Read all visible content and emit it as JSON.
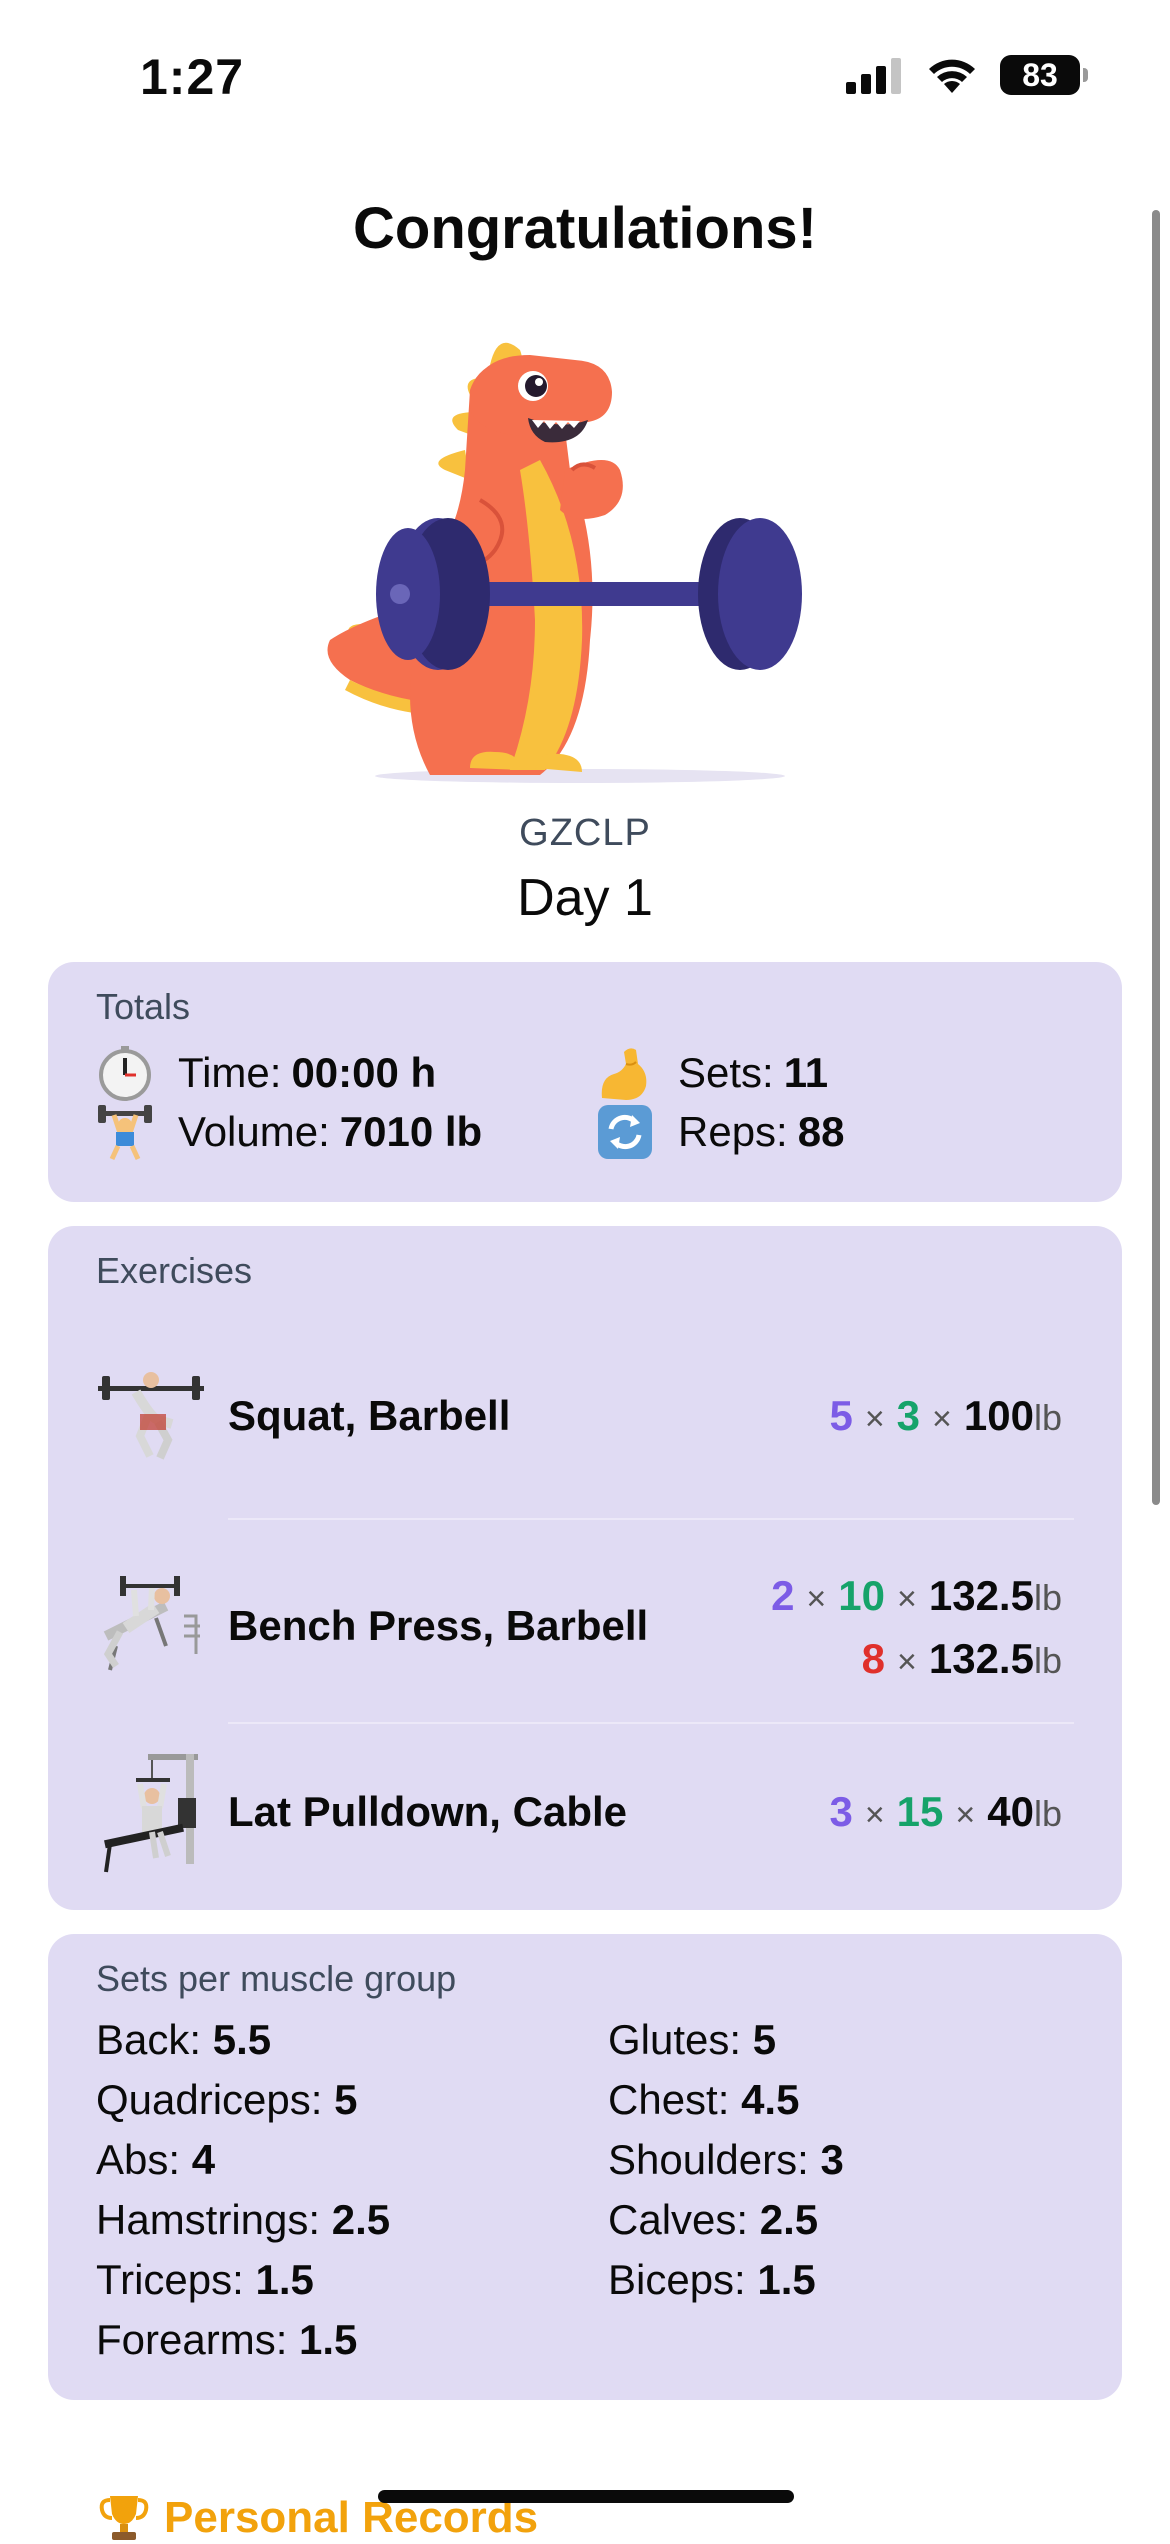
{
  "status_bar": {
    "time": "1:27",
    "battery": "83"
  },
  "header": {
    "title": "Congratulations!"
  },
  "workout": {
    "program": "GZCLP",
    "day": "Day 1"
  },
  "totals": {
    "heading": "Totals",
    "time_label": "Time:",
    "time_value": "00:00 h",
    "volume_label": "Volume:",
    "volume_value": "7010 lb",
    "sets_label": "Sets:",
    "sets_value": "11",
    "reps_label": "Reps:",
    "reps_value": "88"
  },
  "exercises": {
    "heading": "Exercises",
    "items": [
      {
        "name": "Squat, Barbell",
        "lines": [
          {
            "sets": "5",
            "reps": "3",
            "weight": "100",
            "unit": "lb"
          }
        ]
      },
      {
        "name": "Bench Press, Barbell",
        "lines": [
          {
            "sets": "2",
            "reps": "10",
            "weight": "132.5",
            "unit": "lb"
          },
          {
            "reps": "8",
            "weight": "132.5",
            "unit": "lb"
          }
        ]
      },
      {
        "name": "Lat Pulldown, Cable",
        "lines": [
          {
            "sets": "3",
            "reps": "15",
            "weight": "40",
            "unit": "lb"
          }
        ]
      }
    ],
    "times": "×"
  },
  "muscles": {
    "heading": "Sets per muscle group",
    "items": [
      {
        "label": "Back:",
        "value": "5.5"
      },
      {
        "label": "Glutes:",
        "value": "5"
      },
      {
        "label": "Quadriceps:",
        "value": "5"
      },
      {
        "label": "Chest:",
        "value": "4.5"
      },
      {
        "label": "Abs:",
        "value": "4"
      },
      {
        "label": "Shoulders:",
        "value": "3"
      },
      {
        "label": "Hamstrings:",
        "value": "2.5"
      },
      {
        "label": "Calves:",
        "value": "2.5"
      },
      {
        "label": "Triceps:",
        "value": "1.5"
      },
      {
        "label": "Biceps:",
        "value": "1.5"
      },
      {
        "label": "Forearms:",
        "value": "1.5"
      }
    ]
  },
  "records": {
    "heading": "Personal Records"
  },
  "colors": {
    "card": "#e0dbf3",
    "sets": "#7c5ce6",
    "reps": "#16a36a",
    "failed_reps": "#e0302b",
    "records": "#f2a20c"
  },
  "icons": [
    "cellular-icon",
    "wifi-icon",
    "battery-icon",
    "stopwatch-icon",
    "weightlifter-icon",
    "flexed-biceps-icon",
    "repeat-icon",
    "trophy-icon"
  ]
}
